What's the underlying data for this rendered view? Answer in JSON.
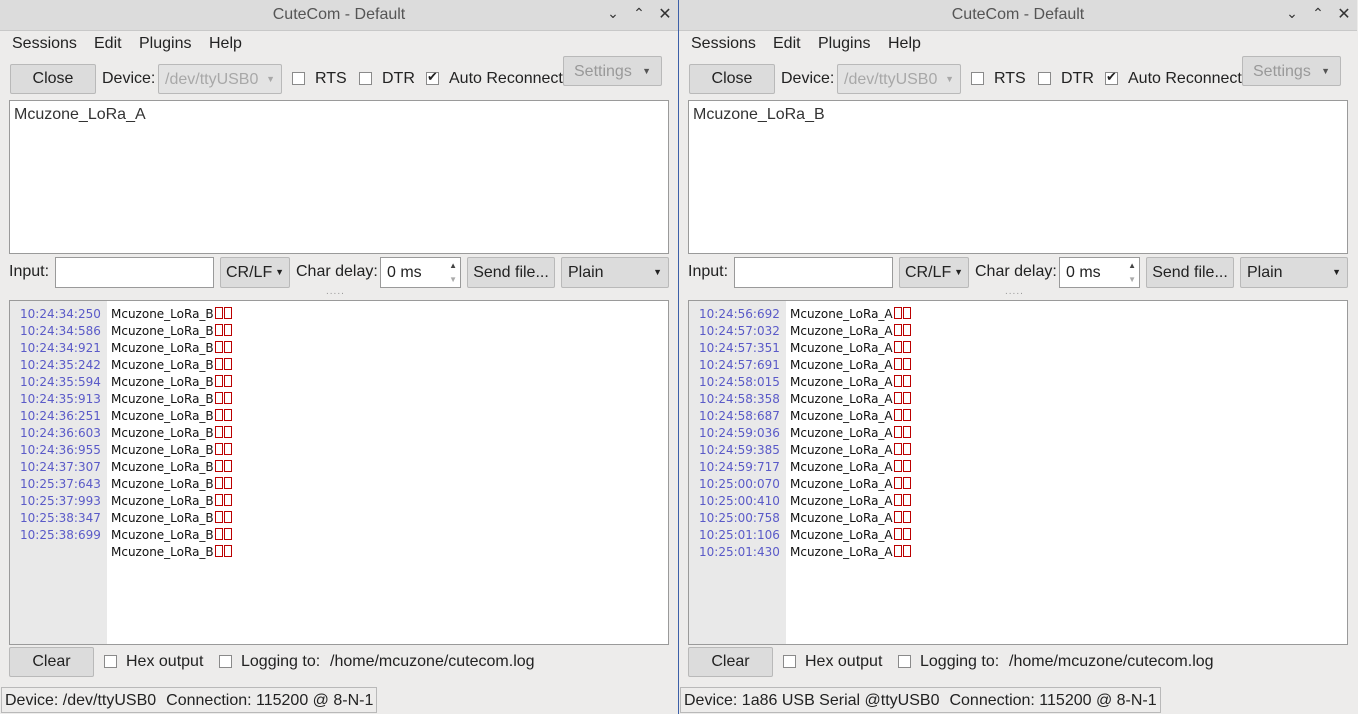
{
  "left": {
    "title": "CuteCom - Default",
    "menu": [
      "Sessions",
      "Edit",
      "Plugins",
      "Help"
    ],
    "close_label": "Close",
    "device_label": "Device:",
    "device_value": "/dev/ttyUSB0",
    "rts_label": "RTS",
    "dtr_label": "DTR",
    "auto_reconnect_label": "Auto Reconnect",
    "settings_label": "Settings",
    "top_text": "Mcuzone_LoRa_A",
    "input_label": "Input:",
    "line_end": "CR/LF",
    "char_delay_label": "Char delay:",
    "char_delay_value": "0 ms",
    "send_file_label": "Send file...",
    "format": "Plain",
    "log": [
      {
        "ts": "10:24:34:250",
        "msg": "Mcuzone_LoRa_B"
      },
      {
        "ts": "10:24:34:586",
        "msg": "Mcuzone_LoRa_B"
      },
      {
        "ts": "10:24:34:921",
        "msg": "Mcuzone_LoRa_B"
      },
      {
        "ts": "10:24:35:242",
        "msg": "Mcuzone_LoRa_B"
      },
      {
        "ts": "10:24:35:594",
        "msg": "Mcuzone_LoRa_B"
      },
      {
        "ts": "10:24:35:913",
        "msg": "Mcuzone_LoRa_B"
      },
      {
        "ts": "10:24:36:251",
        "msg": "Mcuzone_LoRa_B"
      },
      {
        "ts": "10:24:36:603",
        "msg": "Mcuzone_LoRa_B"
      },
      {
        "ts": "10:24:36:955",
        "msg": "Mcuzone_LoRa_B"
      },
      {
        "ts": "10:24:37:307",
        "msg": "Mcuzone_LoRa_B"
      },
      {
        "ts": "10:25:37:643",
        "msg": "Mcuzone_LoRa_B"
      },
      {
        "ts": "10:25:37:993",
        "msg": "Mcuzone_LoRa_B"
      },
      {
        "ts": "10:25:38:347",
        "msg": "Mcuzone_LoRa_B"
      },
      {
        "ts": "10:25:38:699",
        "msg": "Mcuzone_LoRa_B"
      },
      {
        "ts": "",
        "msg": "Mcuzone_LoRa_B"
      }
    ],
    "clear_label": "Clear",
    "hex_output_label": "Hex output",
    "logging_label": "Logging to:",
    "log_path": "/home/mcuzone/cutecom.log",
    "status_device": "Device:  /dev/ttyUSB0",
    "status_connection": "Connection:  115200 @ 8-N-1"
  },
  "right": {
    "title": "CuteCom - Default",
    "menu": [
      "Sessions",
      "Edit",
      "Plugins",
      "Help"
    ],
    "close_label": "Close",
    "device_label": "Device:",
    "device_value": "/dev/ttyUSB0",
    "rts_label": "RTS",
    "dtr_label": "DTR",
    "auto_reconnect_label": "Auto Reconnect",
    "settings_label": "Settings",
    "top_text": "Mcuzone_LoRa_B",
    "input_label": "Input:",
    "line_end": "CR/LF",
    "char_delay_label": "Char delay:",
    "char_delay_value": "0 ms",
    "send_file_label": "Send file...",
    "format": "Plain",
    "log": [
      {
        "ts": "10:24:56:692",
        "msg": "Mcuzone_LoRa_A"
      },
      {
        "ts": "10:24:57:032",
        "msg": "Mcuzone_LoRa_A"
      },
      {
        "ts": "10:24:57:351",
        "msg": "Mcuzone_LoRa_A"
      },
      {
        "ts": "10:24:57:691",
        "msg": "Mcuzone_LoRa_A"
      },
      {
        "ts": "10:24:58:015",
        "msg": "Mcuzone_LoRa_A"
      },
      {
        "ts": "10:24:58:358",
        "msg": "Mcuzone_LoRa_A"
      },
      {
        "ts": "10:24:58:687",
        "msg": "Mcuzone_LoRa_A"
      },
      {
        "ts": "10:24:59:036",
        "msg": "Mcuzone_LoRa_A"
      },
      {
        "ts": "10:24:59:385",
        "msg": "Mcuzone_LoRa_A"
      },
      {
        "ts": "10:24:59:717",
        "msg": "Mcuzone_LoRa_A"
      },
      {
        "ts": "10:25:00:070",
        "msg": "Mcuzone_LoRa_A"
      },
      {
        "ts": "10:25:00:410",
        "msg": "Mcuzone_LoRa_A"
      },
      {
        "ts": "10:25:00:758",
        "msg": "Mcuzone_LoRa_A"
      },
      {
        "ts": "10:25:01:106",
        "msg": "Mcuzone_LoRa_A"
      },
      {
        "ts": "10:25:01:430",
        "msg": "Mcuzone_LoRa_A"
      }
    ],
    "clear_label": "Clear",
    "hex_output_label": "Hex output",
    "logging_label": "Logging to:",
    "log_path": "/home/mcuzone/cutecom.log",
    "status_device": "Device:  1a86 USB Serial @ttyUSB0",
    "status_connection": "Connection:  115200 @ 8-N-1"
  }
}
